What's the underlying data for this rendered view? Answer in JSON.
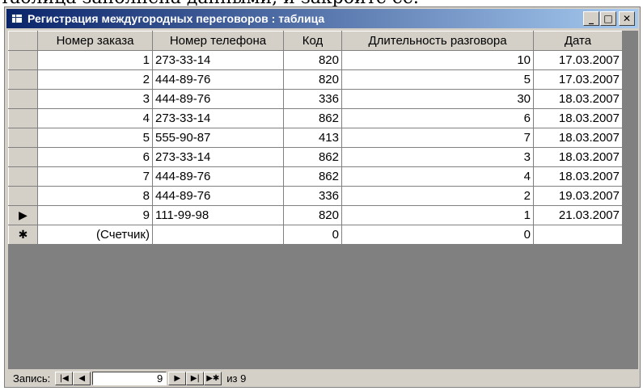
{
  "page_caption": "таблица заполнена данными, и закройте ее.",
  "window": {
    "title": "Регистрация междугородных переговоров : таблица",
    "minimize_icon": "minimize-icon",
    "maximize_icon": "maximize-icon",
    "close_icon": "close-icon"
  },
  "table": {
    "columns": [
      "Номер заказа",
      "Номер телефона",
      "Код",
      "Длительность разговора",
      "Дата"
    ],
    "rows": [
      [
        "1",
        "273-33-14",
        "820",
        "10",
        "17.03.2007"
      ],
      [
        "2",
        "444-89-76",
        "820",
        "5",
        "17.03.2007"
      ],
      [
        "3",
        "444-89-76",
        "336",
        "30",
        "18.03.2007"
      ],
      [
        "4",
        "273-33-14",
        "862",
        "6",
        "18.03.2007"
      ],
      [
        "5",
        "555-90-87",
        "413",
        "7",
        "18.03.2007"
      ],
      [
        "6",
        "273-33-14",
        "862",
        "3",
        "18.03.2007"
      ],
      [
        "7",
        "444-89-76",
        "862",
        "4",
        "18.03.2007"
      ],
      [
        "8",
        "444-89-76",
        "336",
        "2",
        "19.03.2007"
      ],
      [
        "9",
        "111-99-98",
        "820",
        "1",
        "21.03.2007"
      ]
    ],
    "current_row_marker": "▶",
    "new_row": {
      "marker": "✱",
      "cells": [
        "(Счетчик)",
        "",
        "0",
        "0",
        ""
      ]
    }
  },
  "navigator": {
    "label": "Запись:",
    "first": "first-record-icon",
    "prev": "previous-record-icon",
    "current": "9",
    "next": "next-record-icon",
    "last": "last-record-icon",
    "new": "new-record-icon",
    "total_text": "из 9"
  }
}
